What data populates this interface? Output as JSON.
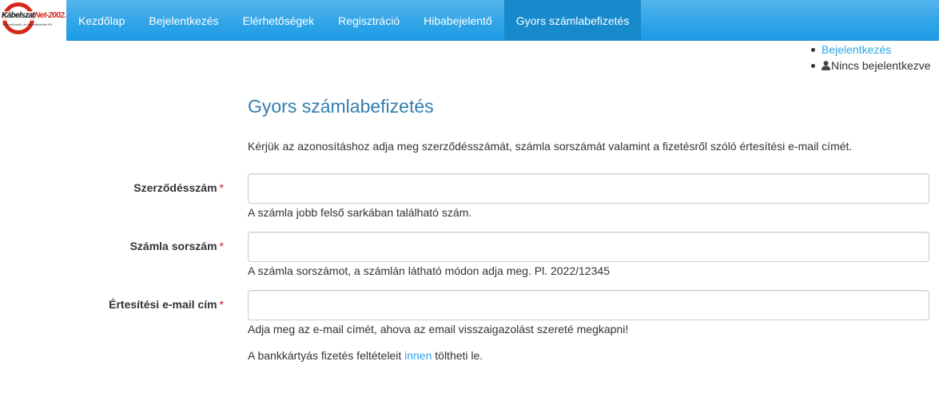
{
  "brand": {
    "name_part1": "Kábelszat",
    "name_part2": "Net-2002.",
    "subtitle": "Műsorelosztó- és Kereskedelmi Kft."
  },
  "nav": {
    "items": [
      {
        "label": "Kezdőlap",
        "active": false
      },
      {
        "label": "Bejelentkezés",
        "active": false
      },
      {
        "label": "Elérhetőségek",
        "active": false
      },
      {
        "label": "Regisztráció",
        "active": false
      },
      {
        "label": "Hibabejelentő",
        "active": false
      },
      {
        "label": "Gyors számlabefizetés",
        "active": true
      }
    ]
  },
  "usermenu": {
    "login_link": "Bejelentkezés",
    "status": "Nincs bejelentkezve",
    "status_icon": "user-icon"
  },
  "page": {
    "title": "Gyors számlabefizetés",
    "intro": "Kérjük az azonosításhoz adja meg szerződésszámát, számla sorszámát valamint a fizetésről szóló értesítési e-mail címét."
  },
  "form": {
    "required_marker": "*",
    "fields": [
      {
        "label": "Szerződésszám",
        "value": "",
        "placeholder": "",
        "help": "A számla jobb felső sarkában található szám."
      },
      {
        "label": "Számla sorszám",
        "value": "",
        "placeholder": "",
        "help": "A számla sorszámot, a számlán látható módon adja meg. Pl. 2022/12345"
      },
      {
        "label": "Értesítési e-mail cím",
        "value": "",
        "placeholder": "",
        "help": "Adja meg az e-mail címét, ahova az email visszaigazolást szereté megkapni!"
      }
    ]
  },
  "footer_note": {
    "before": "A bankkártyás fizetés feltételeit",
    "link": "innen",
    "after": "töltheti le."
  },
  "colors": {
    "navbar": "#2fa4e7",
    "navbar_active": "#178acc",
    "title": "#317eac",
    "link": "#2fa4e7",
    "required": "#c71c22",
    "logo_red": "#d9261c"
  }
}
